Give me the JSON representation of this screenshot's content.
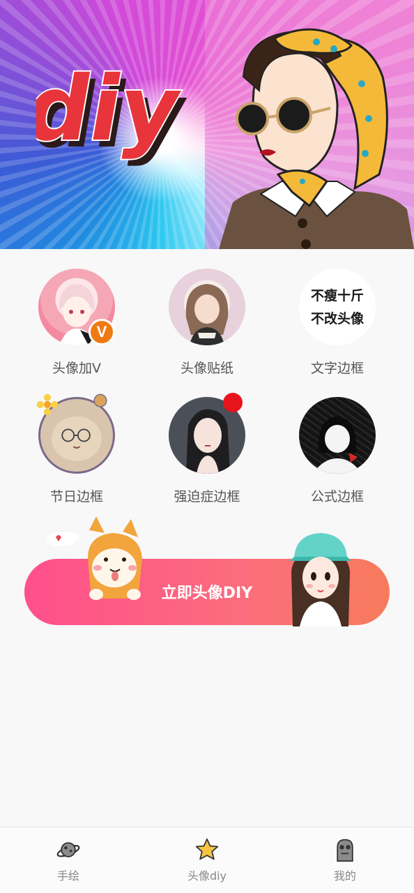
{
  "banner": {
    "logo_text": "diy"
  },
  "features": [
    {
      "label": "头像加V",
      "badge": "V"
    },
    {
      "label": "头像贴纸"
    },
    {
      "label": "文字边框",
      "thumb_text_line1": "不瘦十斤",
      "thumb_text_line2": "不改头像"
    },
    {
      "label": "节日边框"
    },
    {
      "label": "强迫症边框"
    },
    {
      "label": "公式边框"
    }
  ],
  "cta": {
    "label": "立即头像DIY"
  },
  "tabbar": {
    "tabs": [
      {
        "label": "手绘",
        "icon": "planet-icon"
      },
      {
        "label": "头像diy",
        "icon": "star-icon"
      },
      {
        "label": "我的",
        "icon": "robot-face-icon"
      }
    ]
  },
  "colors": {
    "cta_start": "#ff4f8c",
    "cta_end": "#f77b5c",
    "badge_orange": "#f07a12",
    "dot_red": "#e8141c"
  }
}
